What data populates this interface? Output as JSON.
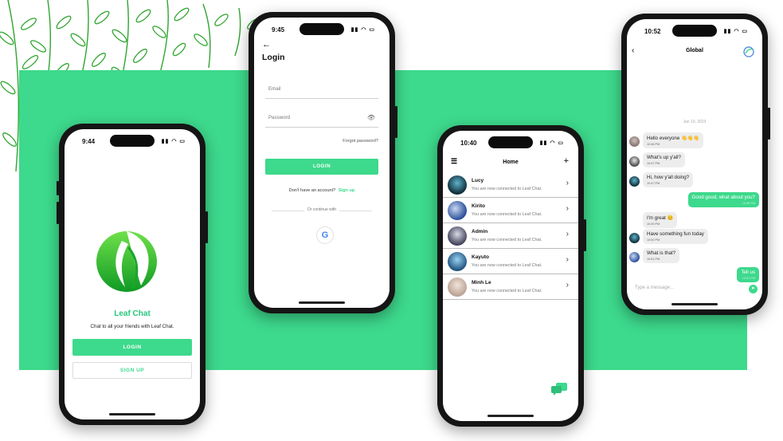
{
  "colors": {
    "accent": "#3dd98c",
    "band": "#3dd98c"
  },
  "welcome": {
    "time": "9:44",
    "app_title": "Leaf Chat",
    "subtitle": "Chat to all your friends with Leaf Chat.",
    "login_label": "LOGIN",
    "signup_label": "SIGN UP"
  },
  "login": {
    "time": "9:45",
    "title": "Login",
    "email_placeholder": "Email",
    "password_placeholder": "Password",
    "forgot": "Forgot password?",
    "login_label": "LOGIN",
    "no_account": "Don't have an account?",
    "signup_link": "Sign up",
    "or_continue": "Or continue with",
    "google_icon": "google-icon"
  },
  "home": {
    "time": "10:40",
    "title": "Home",
    "contacts": [
      {
        "name": "Lucy",
        "message": "You are now connected to Leaf Chat."
      },
      {
        "name": "Kirito",
        "message": "You are now connected to Leaf Chat."
      },
      {
        "name": "Admin",
        "message": "You are now connected to Leaf Chat."
      },
      {
        "name": "Kayuto",
        "message": "You are now connected to Leaf Chat."
      },
      {
        "name": "Minh Le",
        "message": "You are now connected to Leaf Chat."
      }
    ]
  },
  "chat": {
    "time": "10:52",
    "title": "Global",
    "date": "Jan 10, 2023",
    "messages": [
      {
        "text": "Hello everyone 👋👋👋",
        "time": "10:46 PM",
        "side": "left"
      },
      {
        "text": "What's up y'all?",
        "time": "10:47 PM",
        "side": "left"
      },
      {
        "text": "Hi, how y'all doing?",
        "time": "10:47 PM",
        "side": "left"
      },
      {
        "text": "Good good, what about you?",
        "time": "10:48 PM",
        "side": "right"
      },
      {
        "text": "I'm great 😊",
        "time": "10:49 PM",
        "side": "left"
      },
      {
        "text": "Have something fun today",
        "time": "10:50 PM",
        "side": "left"
      },
      {
        "text": "What is that?",
        "time": "10:51 PM",
        "side": "left"
      },
      {
        "text": "Tell us",
        "time": "10:51 PM",
        "side": "right"
      }
    ],
    "input_placeholder": "Type a message..."
  }
}
